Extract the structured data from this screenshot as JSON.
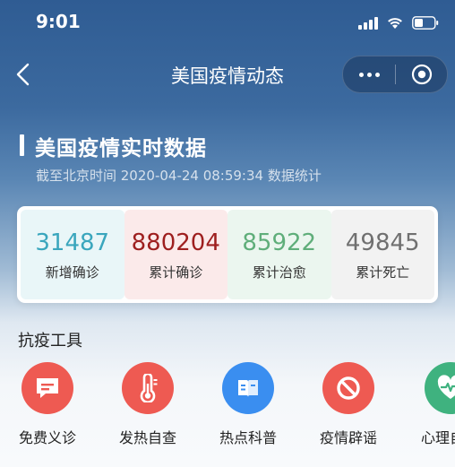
{
  "status_bar": {
    "time": "9:01"
  },
  "nav": {
    "title": "美国疫情动态"
  },
  "section": {
    "title": "美国疫情实时数据",
    "update_time": "截至北京时间 2020-04-24 08:59:34 数据统计"
  },
  "stats": [
    {
      "value": "31487",
      "label": "新增确诊",
      "color": "#3aa6bd",
      "bg": "#e9f6f8"
    },
    {
      "value": "880204",
      "label": "累计确诊",
      "color": "#9e1f1f",
      "bg": "#fbeaea"
    },
    {
      "value": "85922",
      "label": "累计治愈",
      "color": "#5fae7a",
      "bg": "#ebf6ef"
    },
    {
      "value": "49845",
      "label": "累计死亡",
      "color": "#707070",
      "bg": "#f2f2f2"
    }
  ],
  "tools": {
    "title": "抗疫工具",
    "items": [
      {
        "label": "免费义诊",
        "icon": "chat-icon",
        "color": "#ee5a52"
      },
      {
        "label": "发热自查",
        "icon": "thermometer-icon",
        "color": "#ee5a52"
      },
      {
        "label": "热点科普",
        "icon": "book-icon",
        "color": "#3a8ef0"
      },
      {
        "label": "疫情辟谣",
        "icon": "prohibit-icon",
        "color": "#ee5a52"
      },
      {
        "label": "心理自",
        "icon": "heart-pulse-icon",
        "color": "#3fb27f"
      }
    ]
  }
}
